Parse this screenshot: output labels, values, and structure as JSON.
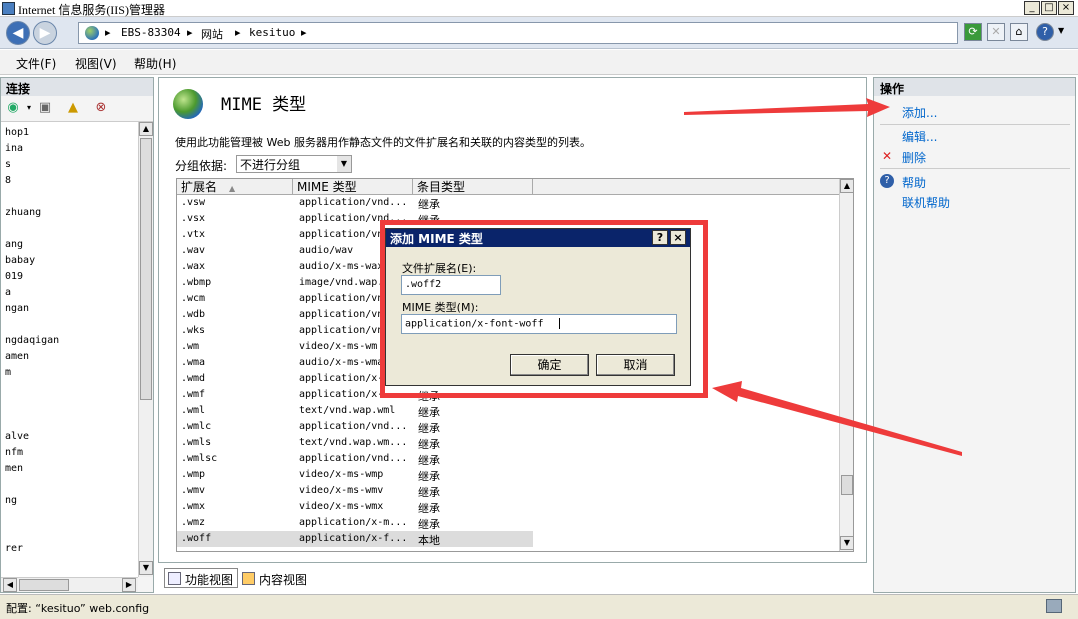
{
  "window": {
    "title": "Internet 信息服务(IIS)管理器",
    "buttons": [
      "_",
      "□",
      "×"
    ]
  },
  "address": {
    "crumbs": [
      "EBS-83304",
      "网站",
      "kesituo"
    ],
    "separator": "▸"
  },
  "menu": [
    "文件(F)",
    "视图(V)",
    "帮助(H)"
  ],
  "connections": {
    "header": "连接",
    "tree_items": [
      "hop1",
      "ina",
      "s",
      "8",
      "zhuang",
      "ang",
      "babay",
      "019",
      "a",
      "ngan",
      "ngdaqigan",
      "amen",
      "m",
      "alve",
      "nfm",
      "men",
      "ng",
      "rer"
    ]
  },
  "main": {
    "title": "MIME 类型",
    "description": "使用此功能管理被 Web 服务器用作静态文件的文件扩展名和关联的内容类型的列表。",
    "group_by_label": "分组依据:",
    "group_by_value": "不进行分组",
    "columns": [
      "扩展名",
      "MIME 类型",
      "条目类型"
    ],
    "rows": [
      [
        ".vsw",
        "application/vnd...",
        "继承"
      ],
      [
        ".vsx",
        "application/vnd...",
        "继承"
      ],
      [
        ".vtx",
        "application/vn",
        "继承"
      ],
      [
        ".wav",
        "audio/wav",
        "继承"
      ],
      [
        ".wax",
        "audio/x-ms-wax",
        "继承"
      ],
      [
        ".wbmp",
        "image/vnd.wap.",
        "继承"
      ],
      [
        ".wcm",
        "application/vn",
        "继承"
      ],
      [
        ".wdb",
        "application/vn",
        "继承"
      ],
      [
        ".wks",
        "application/vn",
        "继承"
      ],
      [
        ".wm",
        "video/x-ms-wm",
        "继承"
      ],
      [
        ".wma",
        "audio/x-ms-wma",
        "继承"
      ],
      [
        ".wmd",
        "application/x-",
        "继承"
      ],
      [
        ".wmf",
        "application/x-",
        "继承"
      ],
      [
        ".wml",
        "text/vnd.wap.wml",
        "继承"
      ],
      [
        ".wmlc",
        "application/vnd...",
        "继承"
      ],
      [
        ".wmls",
        "text/vnd.wap.wm...",
        "继承"
      ],
      [
        ".wmlsc",
        "application/vnd...",
        "继承"
      ],
      [
        ".wmp",
        "video/x-ms-wmp",
        "继承"
      ],
      [
        ".wmv",
        "video/x-ms-wmv",
        "继承"
      ],
      [
        ".wmx",
        "video/x-ms-wmx",
        "继承"
      ],
      [
        ".wmz",
        "application/x-m...",
        "继承"
      ],
      [
        ".woff",
        "application/x-f...",
        "本地"
      ]
    ],
    "selected_row": 21
  },
  "tabs": [
    "功能视图",
    "内容视图"
  ],
  "actions": {
    "header": "操作",
    "add": "添加...",
    "edit": "编辑...",
    "delete": "删除",
    "help": "帮助",
    "online_help": "联机帮助"
  },
  "status": {
    "text": "配置: “kesituo” web.config"
  },
  "dialog": {
    "title": "添加 MIME 类型",
    "help_btn": "?",
    "close_btn": "×",
    "ext_label": "文件扩展名(E):",
    "ext_value": ".woff2",
    "mime_label": "MIME 类型(M):",
    "mime_value": "application/x-font-woff",
    "ok": "确定",
    "cancel": "取消"
  },
  "colors": {
    "highlight": "#ee3b3b",
    "dialog_title": "#0a246a",
    "link": "#0066cc"
  }
}
